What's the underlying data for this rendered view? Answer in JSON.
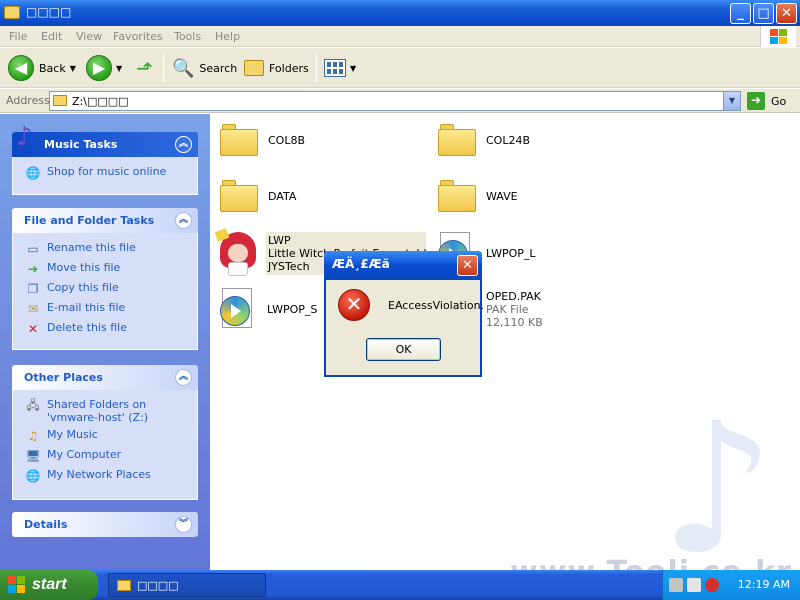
{
  "window": {
    "title": "□□□□",
    "controls": {
      "minimize": "_",
      "maximize": "□",
      "close": "✕"
    }
  },
  "menu": [
    "File",
    "Edit",
    "View",
    "Favorites",
    "Tools",
    "Help"
  ],
  "toolbar": {
    "back_label": "Back",
    "search_label": "Search",
    "folders_label": "Folders"
  },
  "address": {
    "label": "Address",
    "value": "Z:\\□□□□",
    "go_label": "Go"
  },
  "sidebar": {
    "music_tasks": {
      "title": "Music Tasks",
      "items": [
        {
          "label": "Shop for music online",
          "icon": "globe-icon"
        }
      ]
    },
    "file_folder_tasks": {
      "title": "File and Folder Tasks",
      "items": [
        {
          "label": "Rename this file",
          "icon": "rename-icon"
        },
        {
          "label": "Move this file",
          "icon": "move-icon"
        },
        {
          "label": "Copy this file",
          "icon": "copy-icon"
        },
        {
          "label": "E-mail this file",
          "icon": "email-icon"
        },
        {
          "label": "Delete this file",
          "icon": "delete-icon"
        }
      ]
    },
    "other_places": {
      "title": "Other Places",
      "items": [
        {
          "label": "Shared Folders on",
          "label2": "'vmware-host' (Z:)",
          "icon": "network-drive-icon"
        },
        {
          "label": "My Music",
          "icon": "my-music-icon"
        },
        {
          "label": "My Computer",
          "icon": "my-computer-icon"
        },
        {
          "label": "My Network Places",
          "icon": "network-places-icon"
        }
      ]
    },
    "details": {
      "title": "Details"
    }
  },
  "files": [
    {
      "name": "COL8B",
      "type": "folder"
    },
    {
      "name": "COL24B",
      "type": "folder"
    },
    {
      "name": "DATA",
      "type": "folder"
    },
    {
      "name": "WAVE",
      "type": "folder"
    },
    {
      "name": "LWP",
      "line2": "Little Witch Parfait Executable",
      "line3": "JYSTech",
      "type": "exe"
    },
    {
      "name": "LWPOP_L",
      "type": "media"
    },
    {
      "name": "LWPOP_S",
      "type": "media"
    },
    {
      "name": "OPED.PAK",
      "line2": "PAK File",
      "line3": "12,110 KB",
      "type": "pak"
    }
  ],
  "dialog": {
    "title": "ÆÄ¸£Æä",
    "message": "EAccessViolation.",
    "ok_label": "OK"
  },
  "taskbar": {
    "start_label": "start",
    "window_label": "□□□□",
    "clock": "12:19 AM"
  },
  "watermark": "www.Tooli.co.kr",
  "colors": {
    "xp_blue": "#0a46bb",
    "task_link": "#215dc6",
    "start_green": "#3a8d31",
    "error_red": "#c41a0b"
  }
}
